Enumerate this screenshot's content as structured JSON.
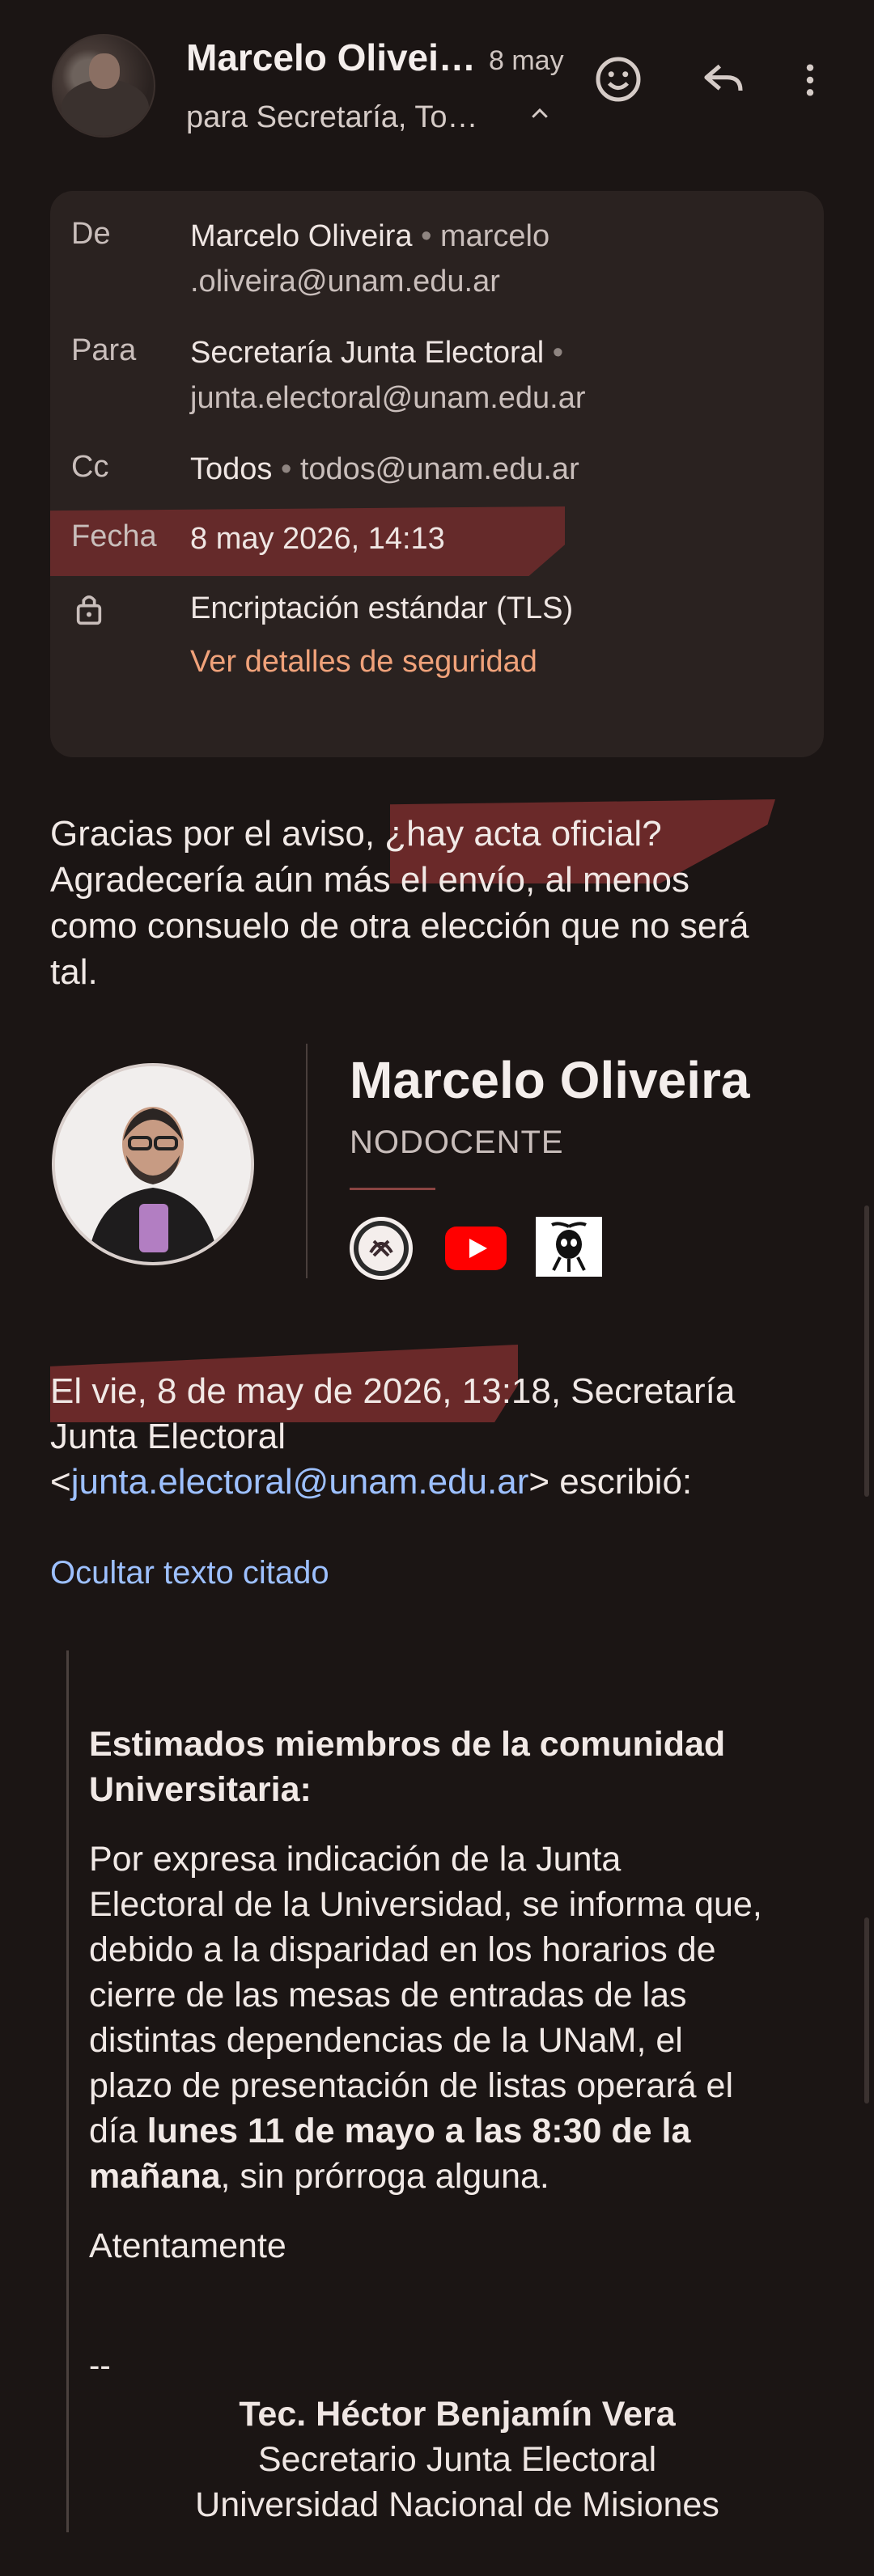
{
  "header": {
    "sender_name": "Marcelo Olivei…",
    "date": "8 may",
    "recipients_summary": "para Secretaría, To…"
  },
  "details": {
    "from_label": "De",
    "from_name": "Marcelo Oliveira",
    "from_email_1": "marcelo",
    "from_email_2": ".oliveira@unam.edu.ar",
    "to_label": "Para",
    "to_name": "Secretaría Junta Electoral",
    "to_email": "junta.electoral@unam.edu.ar",
    "cc_label": "Cc",
    "cc_name": "Todos",
    "cc_email": "todos@unam.edu.ar",
    "date_label": "Fecha",
    "date_value": "8 may 2026, 14:13",
    "encryption": "Encriptación estándar (TLS)",
    "security_link": "Ver detalles de seguridad"
  },
  "body": {
    "line1_a": "Gracias por el aviso, ",
    "line1_b": "¿hay acta oficial?",
    "line2": "Agradecería aún más el envío, al menos",
    "line3": "como consuelo de otra elección que no será",
    "line4": "tal."
  },
  "signature": {
    "name": "Marcelo Oliveira",
    "role": "NODOCENTE"
  },
  "quote_header": {
    "line1": "El vie, 8 de may de 2026, 13:18, Secretaría",
    "line2": "Junta Electoral",
    "line3_a": "<",
    "line3_link": "junta.electoral@unam.edu.ar",
    "line3_b": "> escribió:"
  },
  "toggle_quote": "Ocultar texto citado",
  "quoted": {
    "heading_1": "Estimados miembros de la comunidad",
    "heading_2": "Universitaria:",
    "p1": "Por expresa indicación de la Junta",
    "p2": "Electoral de la Universidad, se informa que,",
    "p3": "debido a la disparidad en los horarios de",
    "p4": "cierre de las mesas de entradas de las",
    "p5": "distintas dependencias de la UNaM, el",
    "p6": "plazo de presentación de listas operará el",
    "p7_a": "día ",
    "p7_bold": "lunes 11 de mayo a las 8:30 de la",
    "p8_bold": "mañana",
    "p8_b": ", sin prórroga alguna.",
    "closing": "Atentamente",
    "dash": "--",
    "sig_name": "Tec. Héctor Benjamín Vera",
    "sig_title": "Secretario Junta Electoral",
    "sig_org": "Universidad Nacional de Misiones"
  },
  "colors": {
    "background": "#1b1514",
    "card": "#2a2220",
    "highlight": "#6a2929",
    "link": "#9dc0ff",
    "security_link": "#f0a27a"
  },
  "icons": [
    "emoji-icon",
    "reply-icon",
    "more-vert-icon",
    "chevron-up-icon",
    "lock-icon",
    "youtube-icon"
  ]
}
